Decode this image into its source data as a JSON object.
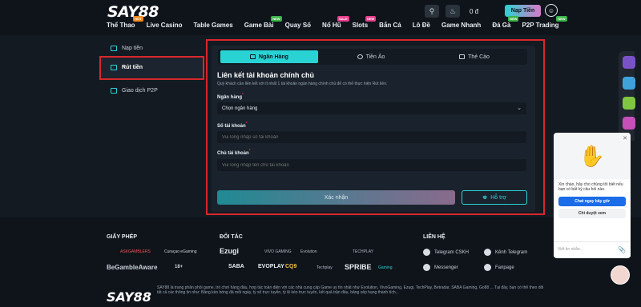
{
  "header": {
    "logo_main": "SAY",
    "logo_num": "88",
    "balance": "0 đ",
    "deposit_label": "Nạp Tiền",
    "nav": [
      {
        "label": "Thể Thao",
        "badge": "HOT",
        "badge_type": "hot"
      },
      {
        "label": "Live Casino",
        "badge": "",
        "badge_type": ""
      },
      {
        "label": "Table Games",
        "badge": "",
        "badge_type": ""
      },
      {
        "label": "Game Bài",
        "badge": "NEW",
        "badge_type": "new"
      },
      {
        "label": "Quay Số",
        "badge": "",
        "badge_type": ""
      },
      {
        "label": "Nổ Hũ",
        "badge": "SALE",
        "badge_type": "pink"
      },
      {
        "label": "Slots",
        "badge": "NEW",
        "badge_type": "pink"
      },
      {
        "label": "Bắn Cá",
        "badge": "",
        "badge_type": ""
      },
      {
        "label": "Lô Đề",
        "badge": "",
        "badge_type": ""
      },
      {
        "label": "Game Nhanh",
        "badge": "",
        "badge_type": ""
      },
      {
        "label": "Đá Gà",
        "badge": "NEW",
        "badge_type": "new"
      },
      {
        "label": "P2P Trading",
        "badge": "NEW",
        "badge_type": "new"
      }
    ]
  },
  "sidebar": {
    "items": [
      {
        "label": "Nạp tiền"
      },
      {
        "label": "Rút tiền"
      },
      {
        "label": "Giao dịch P2P"
      }
    ]
  },
  "tabs": [
    {
      "label": "Ngân Hàng",
      "active": true
    },
    {
      "label": "Tiền Ảo",
      "active": false
    },
    {
      "label": "Thẻ Cào",
      "active": false
    }
  ],
  "form": {
    "title": "Liên kết tài khoản chính chủ",
    "description": "Quý khách cần liên kết với ít nhất 1 tài khoản ngân hàng chính chủ để có thể thực hiện Rút tiền.",
    "bank_label": "Ngân hàng",
    "bank_value": "Chọn ngân hàng",
    "account_no_label": "Số tài khoản",
    "account_no_placeholder": "Vui lòng nhập số tài khoản",
    "account_name_label": "Chủ tài khoản",
    "account_name_placeholder": "Vui lòng nhập tên chủ tài khoản",
    "confirm_label": "Xác nhận",
    "support_label": "Hỗ trợ"
  },
  "footer": {
    "license_heading": "GIẤY PHÉP",
    "partners_heading": "ĐỐI TÁC",
    "contact_heading": "LIÊN HỆ",
    "licenses": [
      "ASKGAMBLERS",
      "Curaçao eGaming",
      "BeGambleAware",
      "18+"
    ],
    "partners": [
      "Ezugi",
      "VIVO GAMING",
      "Evolution",
      "TECHPLAY",
      "SABA",
      "EVOPLAY",
      "CQ9",
      "Techplay",
      "SPRIBE",
      "Gaming"
    ],
    "contacts": [
      {
        "label": "Telegram CSKH"
      },
      {
        "label": "Kênh Telegram"
      },
      {
        "label": "Messenger"
      },
      {
        "label": "Fanpage"
      }
    ],
    "logo": "SAY88",
    "about": "SAY88 là trang phân phối game, trò chơi hàng đầu, hợp tác toàn diện với các nhà cung cấp Game uy tín nhất như Evolution, VivoGaming, Ezugi, TechPlay, Betradar, SABA Gaming, Go88 ... Tại đây, bạn có thể theo dõi tất cả các thông tin như: Bảng kèo bóng đá mỗi ngày, tỷ số trực tuyến, tỷ lệ kèo trực tuyến, kết quả trận đấu, bảng xếp hạng thành tích..."
  },
  "chat": {
    "message": "Xin chào, hãy cho chúng tôi biết nếu bạn có bất kỳ câu hỏi nào.",
    "chat_now": "Chat ngay bây giờ",
    "browse": "Chỉ duyệt xem",
    "input_placeholder": "Viết tin nhắn..."
  }
}
